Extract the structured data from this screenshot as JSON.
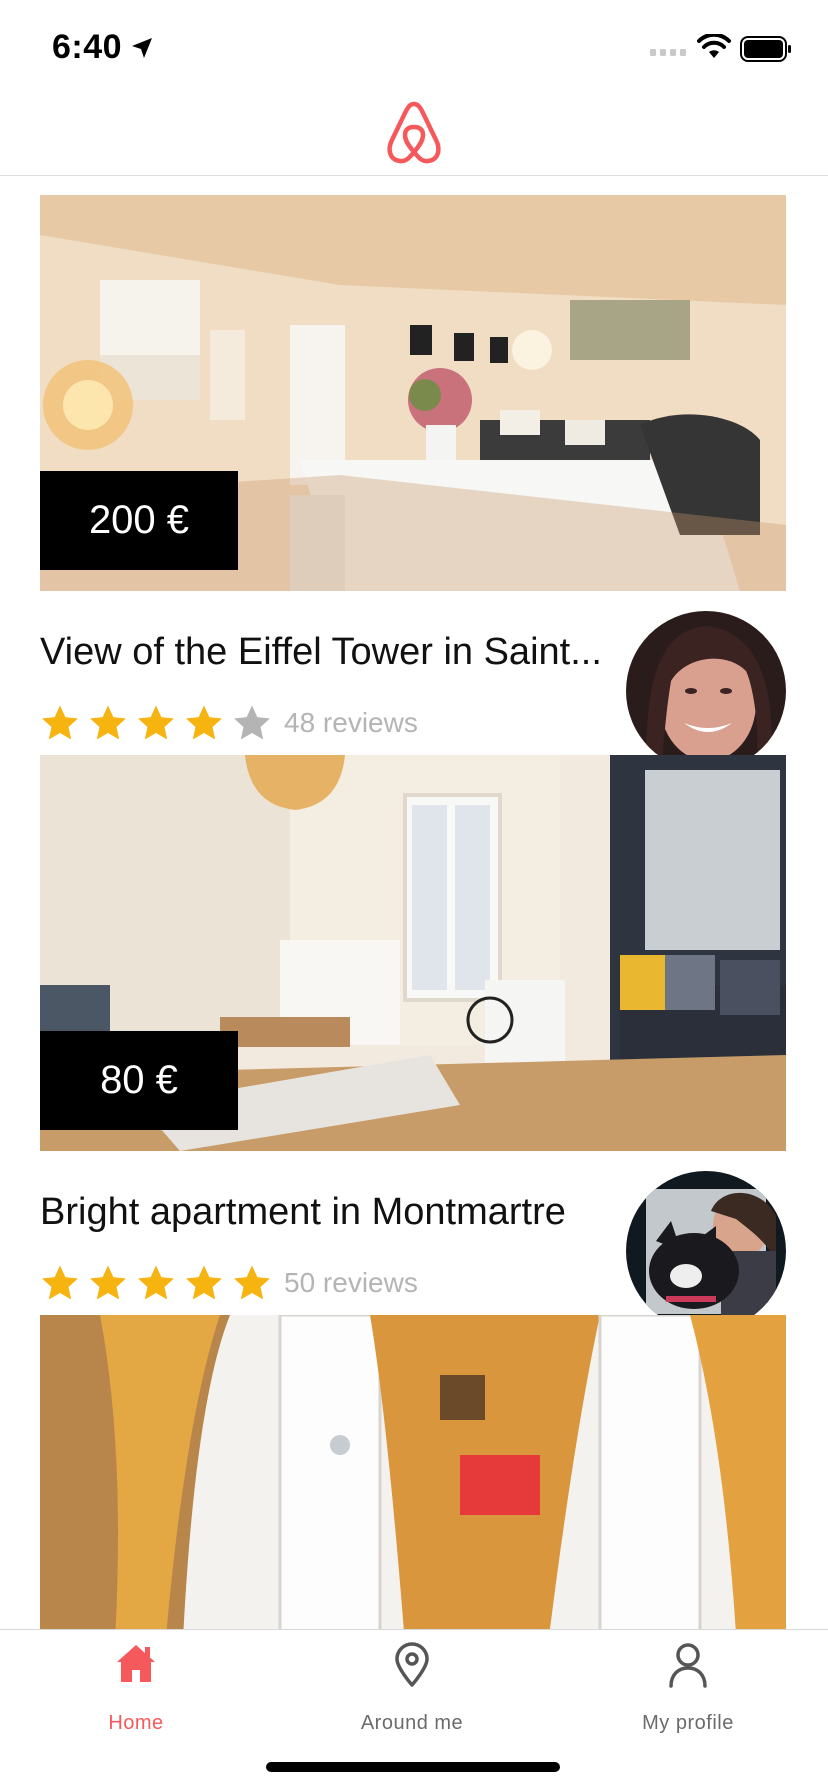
{
  "status_bar": {
    "time": "6:40"
  },
  "colors": {
    "brand": "#f6595c",
    "star_on": "#f5b40f",
    "star_off": "#b4b4b4",
    "price_bg": "#000000"
  },
  "listings": [
    {
      "price": "200 €",
      "title": "View of the Eiffel Tower in Saint...",
      "rating": 4,
      "reviews": "48 reviews"
    },
    {
      "price": "80 €",
      "title": "Bright apartment in Montmartre",
      "rating": 5,
      "reviews": "50 reviews"
    }
  ],
  "tabs": [
    {
      "label": "Home",
      "icon": "home-icon",
      "active": true
    },
    {
      "label": "Around me",
      "icon": "map-pin-icon",
      "active": false
    },
    {
      "label": "My profile",
      "icon": "user-icon",
      "active": false
    }
  ]
}
